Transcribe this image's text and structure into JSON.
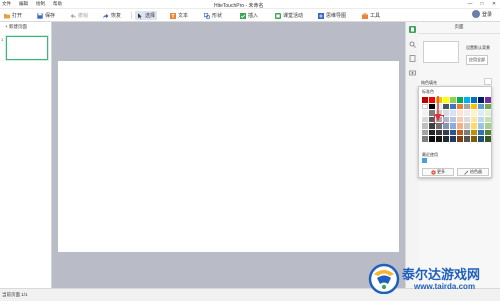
{
  "menu": [
    "文件",
    "编辑",
    "绘制",
    "帮助"
  ],
  "app_title": "HiteTouchPro - 未命名",
  "window_controls": [
    "—",
    "□",
    "✕"
  ],
  "toolbar": {
    "open": "打开",
    "save": "保存",
    "undo": "撤销",
    "redo": "恢复",
    "select": "选择",
    "text": "文本",
    "shape": "形状",
    "insert": "插入",
    "classroom": "课堂活动",
    "mindmap": "思维导图",
    "tools": "工具",
    "login": "登录"
  },
  "slide_panel": {
    "new_page": "+ 新建页面",
    "slide_number": "1"
  },
  "right_panel": {
    "title": "页面",
    "set_default": "设置默认背景",
    "apply_all": "应用全部",
    "fill_label": "纯色填充"
  },
  "color_picker": {
    "standard_label": "标准色",
    "recent_label": "最近使用",
    "more_button": "更多",
    "eyedropper_button": "拾色器",
    "selected_index": 32,
    "recent_color": "#44a1d9",
    "swatches": [
      "#c00000",
      "#ff0000",
      "#ffc000",
      "#ffff00",
      "#92d050",
      "#00b050",
      "#00b0f0",
      "#0070c0",
      "#002060",
      "#7030a0",
      "#ffffff",
      "#000000",
      "#e7e6e6",
      "#44546a",
      "#4472c4",
      "#ed7d31",
      "#a5a5a5",
      "#ffc000",
      "#5b9bd5",
      "#70ad47",
      "#f2f2f2",
      "#7f7f7f",
      "#d0cece",
      "#d6dce4",
      "#d9e2f3",
      "#fbe5d5",
      "#ededed",
      "#fff2cc",
      "#deebf6",
      "#e2efd9",
      "#d8d8d8",
      "#595959",
      "#aeabab",
      "#adb9ca",
      "#b4c6e7",
      "#f7caac",
      "#dbdbdb",
      "#fee599",
      "#bdd7ee",
      "#c5e0b3",
      "#bfbfbf",
      "#3f3f3f",
      "#757070",
      "#8496b0",
      "#8eaadb",
      "#f4b083",
      "#c9c9c9",
      "#ffd965",
      "#9cc3e5",
      "#a8d08d",
      "#a5a5a5",
      "#262626",
      "#3a3838",
      "#323f4f",
      "#2f5496",
      "#c45911",
      "#7b7b7b",
      "#bf9000",
      "#2e75b5",
      "#538135",
      "#7f7f7f",
      "#0c0c0c",
      "#171616",
      "#222a35",
      "#1f3864",
      "#833c0b",
      "#525252",
      "#7f6000",
      "#1f4e79",
      "#375623"
    ]
  },
  "status_bar": "当前页面 1/1",
  "watermark": {
    "title": "泰尔达游戏网",
    "url": "www.tairda.com"
  }
}
